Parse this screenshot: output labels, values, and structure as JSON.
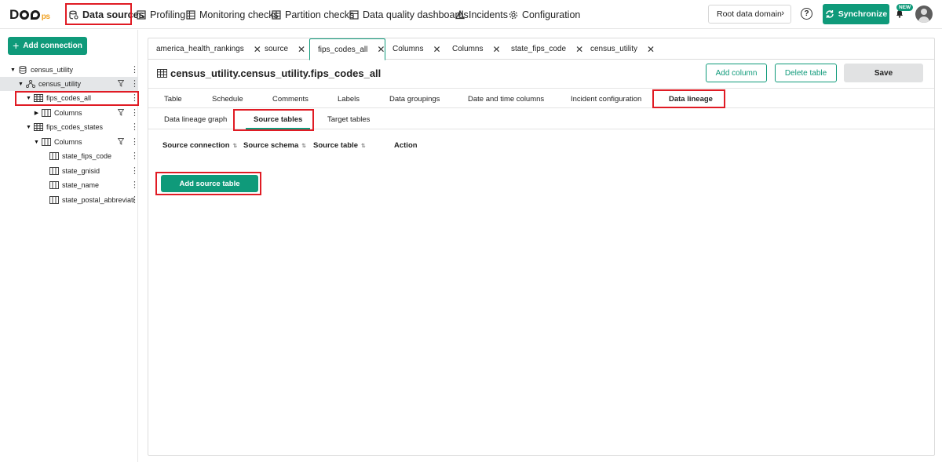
{
  "app": {
    "logo_text": "DQO",
    "logo_suffix": "ps"
  },
  "nav": {
    "items": [
      {
        "label": "Data sources",
        "icon": "database-icon"
      },
      {
        "label": "Profiling",
        "icon": "profiling-icon"
      },
      {
        "label": "Monitoring checks",
        "icon": "table-check-icon"
      },
      {
        "label": "Partition checks",
        "icon": "partition-icon"
      },
      {
        "label": "Data quality dashboards",
        "icon": "dashboard-icon"
      },
      {
        "label": "Incidents",
        "icon": "warning-icon"
      },
      {
        "label": "Configuration",
        "icon": "gear-icon"
      }
    ],
    "domain_label": "Root data domain",
    "help": "?",
    "sync_label": "Synchronize",
    "new_badge": "NEW"
  },
  "sidebar": {
    "add_connection": "Add connection",
    "tree": [
      {
        "label": "census_utility",
        "icon": "connection-icon"
      },
      {
        "label": "census_utility",
        "icon": "schema-icon"
      },
      {
        "label": "fips_codes_all",
        "icon": "table-icon"
      },
      {
        "label": "Columns",
        "icon": "columns-icon"
      },
      {
        "label": "fips_codes_states",
        "icon": "table-icon"
      },
      {
        "label": "Columns",
        "icon": "columns-icon"
      },
      {
        "label": "state_fips_code",
        "icon": "column-icon"
      },
      {
        "label": "state_gnisid",
        "icon": "column-icon"
      },
      {
        "label": "state_name",
        "icon": "column-icon"
      },
      {
        "label": "state_postal_abbreviati",
        "icon": "column-icon"
      }
    ]
  },
  "tabs": [
    {
      "label": "america_health_rankings"
    },
    {
      "label": "source"
    },
    {
      "label": "fips_codes_all"
    },
    {
      "label": "Columns"
    },
    {
      "label": "Columns"
    },
    {
      "label": "state_fips_code"
    },
    {
      "label": "census_utility"
    }
  ],
  "page": {
    "title": "census_utility.census_utility.fips_codes_all",
    "add_column": "Add column",
    "delete_table": "Delete table",
    "save": "Save"
  },
  "subtabs": [
    "Table",
    "Schedule",
    "Comments",
    "Labels",
    "Data groupings",
    "Date and time columns",
    "Incident configuration",
    "Data lineage"
  ],
  "lineage_tabs": [
    "Data lineage graph",
    "Source tables",
    "Target tables"
  ],
  "table": {
    "columns": [
      "Source connection",
      "Source schema",
      "Source table",
      "Action"
    ]
  },
  "add_source_table": "Add source table",
  "colors": {
    "accent": "#0f9a7a",
    "highlight": "#e01b24"
  }
}
